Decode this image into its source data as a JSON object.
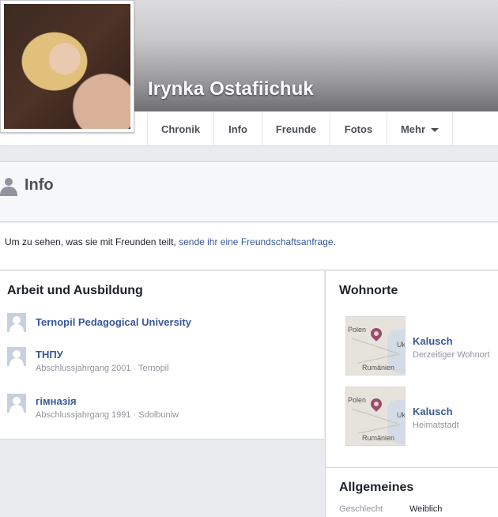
{
  "profile": {
    "name": "Irynka Ostafiichuk"
  },
  "nav": {
    "tabs": [
      {
        "label": "Chronik"
      },
      {
        "label": "Info"
      },
      {
        "label": "Freunde"
      },
      {
        "label": "Fotos"
      },
      {
        "label": "Mehr"
      }
    ]
  },
  "info": {
    "title": "Info",
    "notice_prefix": "Um zu sehen, was sie mit Freunden teilt, ",
    "notice_link": "sende ihr eine Freundschaftsanfrage",
    "notice_suffix": "."
  },
  "work_education": {
    "title": "Arbeit und Ausbildung",
    "items": [
      {
        "name": "Ternopil Pedagogical University",
        "detail": ""
      },
      {
        "name": "ТНПУ",
        "detail": "Abschlussjahrgang 2001 · Ternopil"
      },
      {
        "name": "гімназія",
        "detail": "Abschlussjahrgang 1991 · Sdolbuniw"
      }
    ]
  },
  "places": {
    "title": "Wohnorte",
    "map_labels": {
      "a": "Polen",
      "b": "Ukr",
      "c": "Rumänien"
    },
    "items": [
      {
        "name": "Kalusch",
        "detail": "Derzeitiger Wohnort"
      },
      {
        "name": "Kalusch",
        "detail": "Heimatstadt"
      }
    ]
  },
  "basic": {
    "title": "Allgemeines",
    "gender_label": "Geschlecht",
    "gender_value": "Weiblich"
  },
  "colors": {
    "link": "#365899",
    "nav_text": "#4b4f56",
    "background": "#e9ebee"
  }
}
